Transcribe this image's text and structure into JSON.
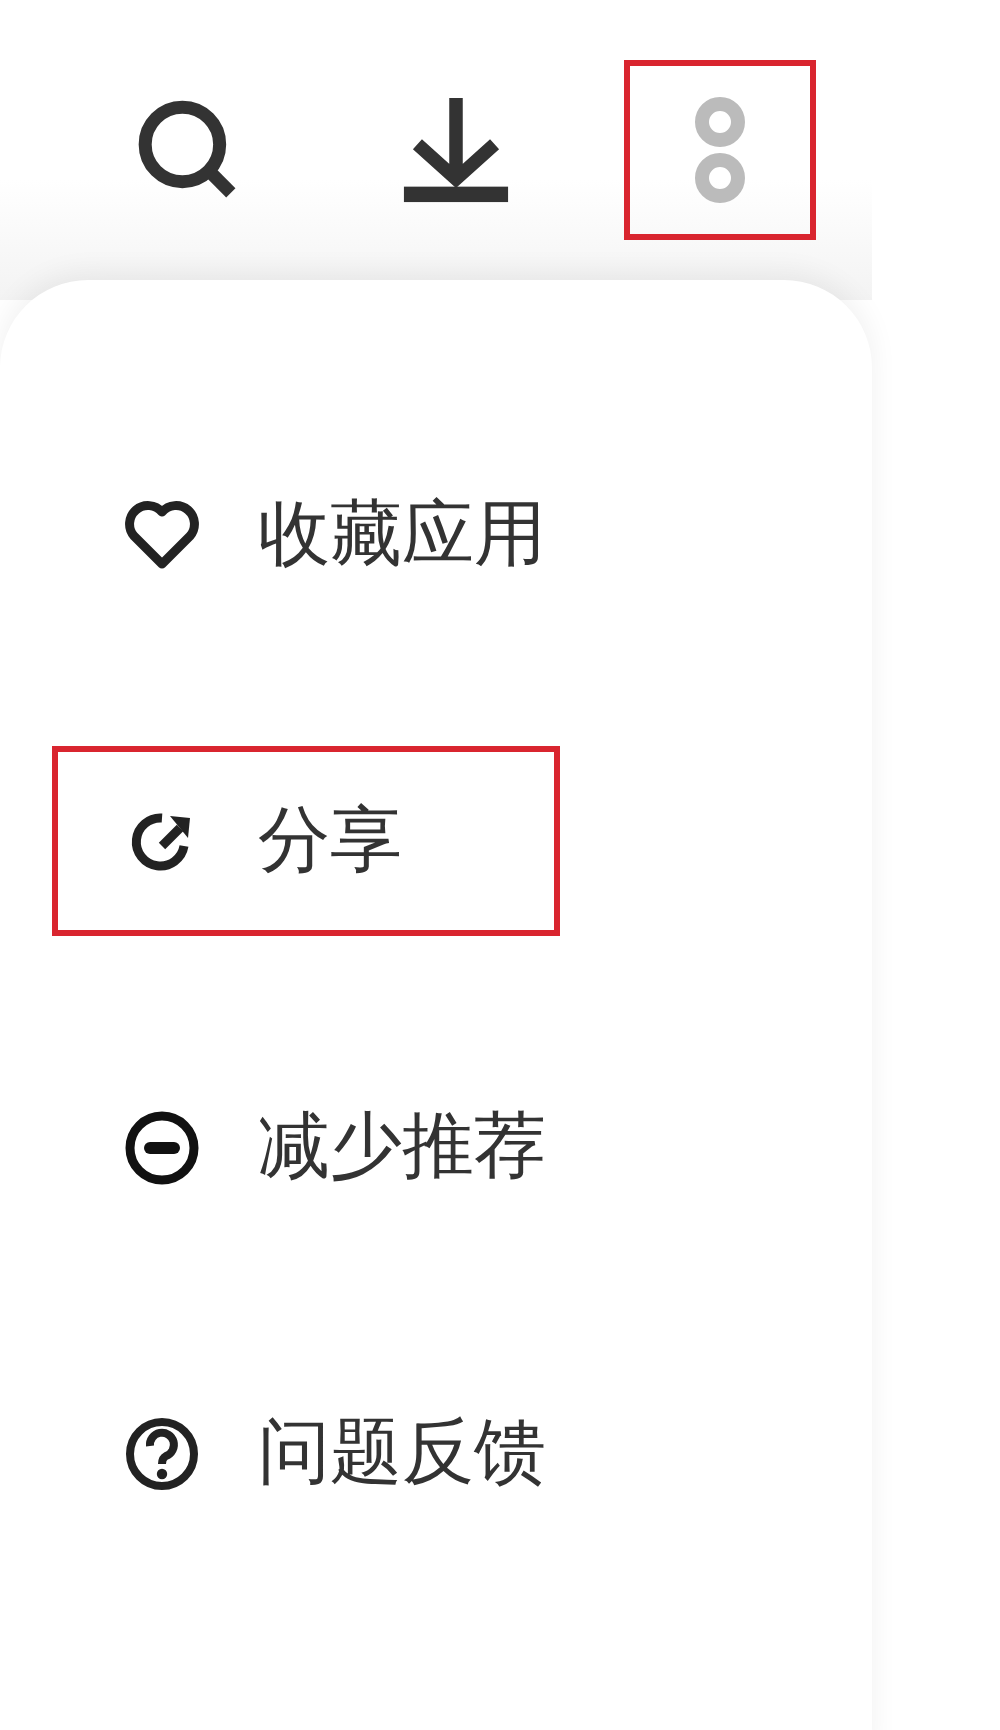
{
  "toolbar": [
    {
      "kind": "search",
      "highlighted": false
    },
    {
      "kind": "download",
      "highlighted": false
    },
    {
      "kind": "more",
      "highlighted": true
    }
  ],
  "menu": {
    "items": [
      {
        "kind": "favorite",
        "label": "收藏应用",
        "highlighted": false
      },
      {
        "kind": "share",
        "label": "分享",
        "highlighted": true
      },
      {
        "kind": "reduce",
        "label": "减少推荐",
        "highlighted": false
      },
      {
        "kind": "feedback",
        "label": "问题反馈",
        "highlighted": false
      }
    ]
  }
}
